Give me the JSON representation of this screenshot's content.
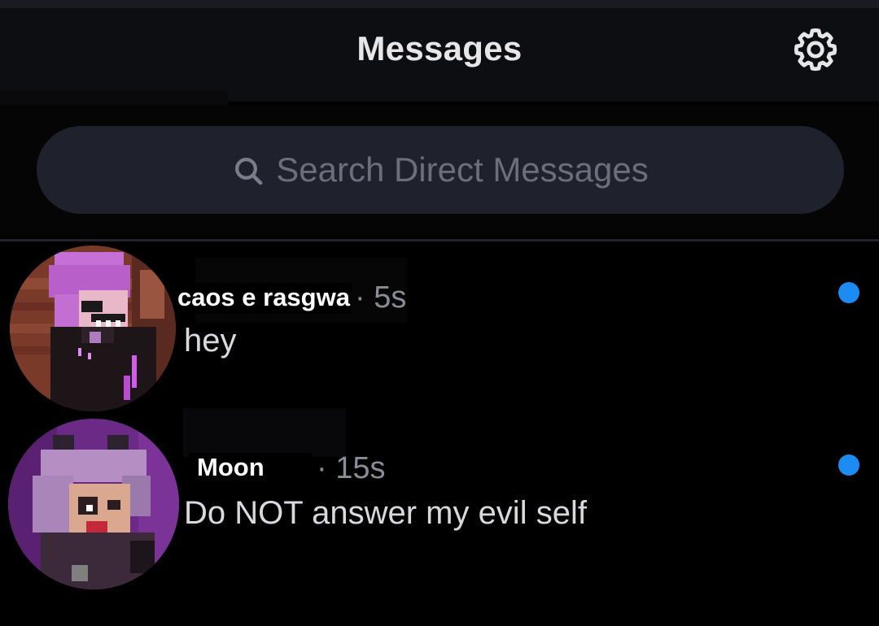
{
  "header": {
    "title": "Messages",
    "settings_icon": "gear-icon"
  },
  "search": {
    "placeholder": "Search Direct Messages",
    "icon": "search-icon"
  },
  "conversations": [
    {
      "name": "caos e rasgwa",
      "time": "· 5s",
      "preview": "hey",
      "unread": true
    },
    {
      "name": "Moon",
      "time": "· 15s",
      "preview": "Do NOT answer my evil self",
      "unread": true
    }
  ],
  "colors": {
    "background": "#000000",
    "search_bg": "#1f212c",
    "unread_dot": "#1d8cf2",
    "muted_text": "#8a8c96"
  }
}
